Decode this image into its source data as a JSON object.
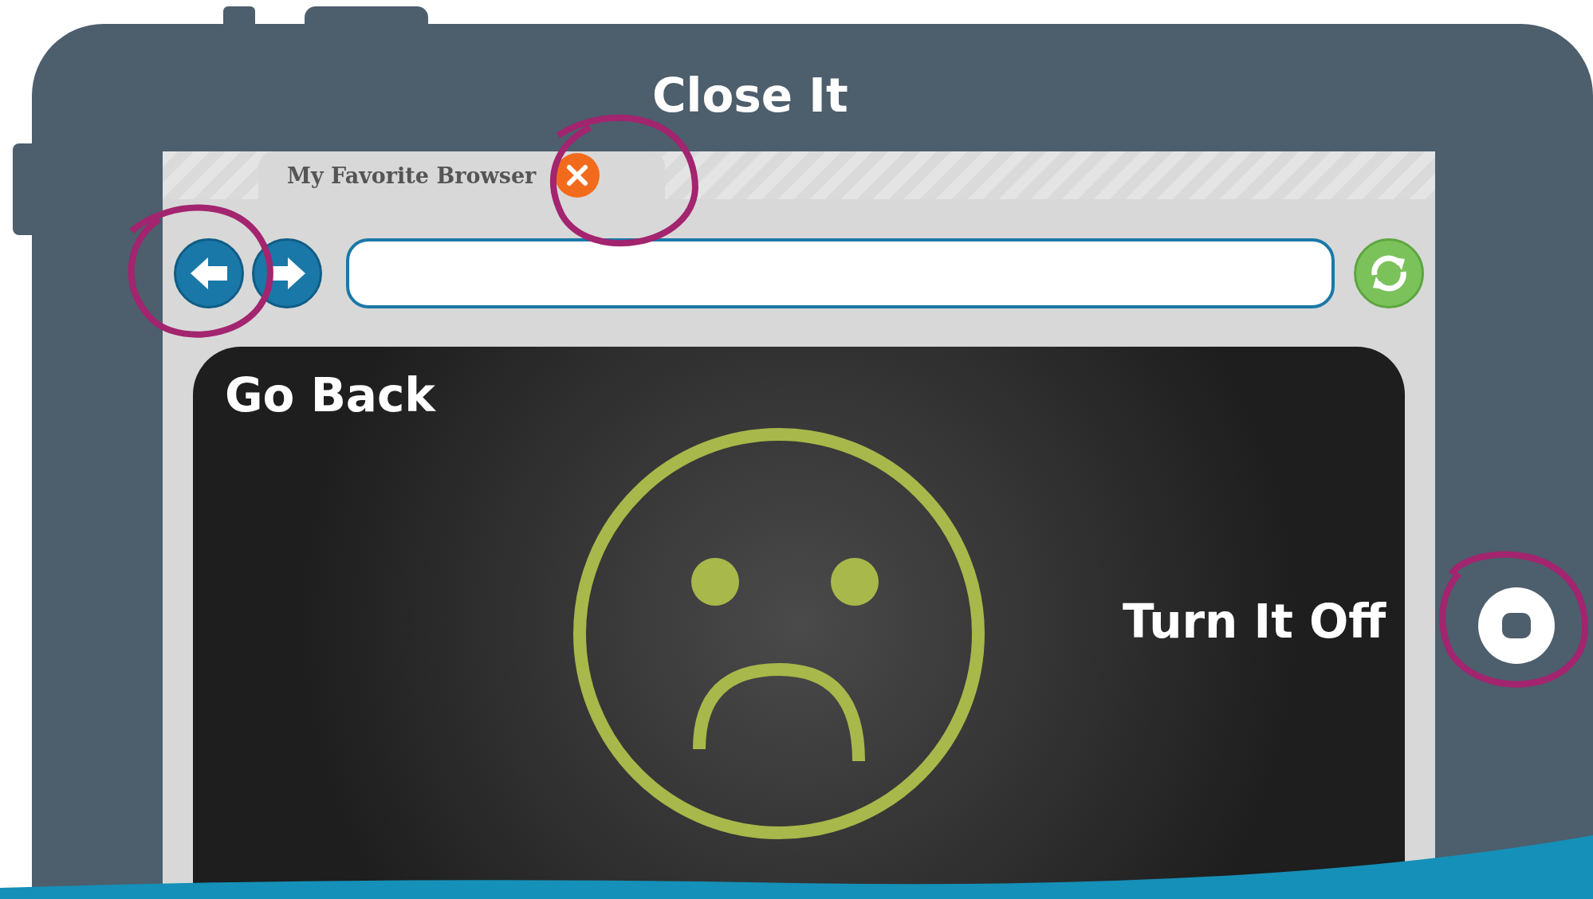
{
  "annotations": [
    {
      "text": "Close It"
    },
    {
      "text": "Go Back"
    },
    {
      "text": "Turn It Off"
    }
  ],
  "browser": {
    "tab": {
      "title": "My Favorite Browser"
    }
  }
}
